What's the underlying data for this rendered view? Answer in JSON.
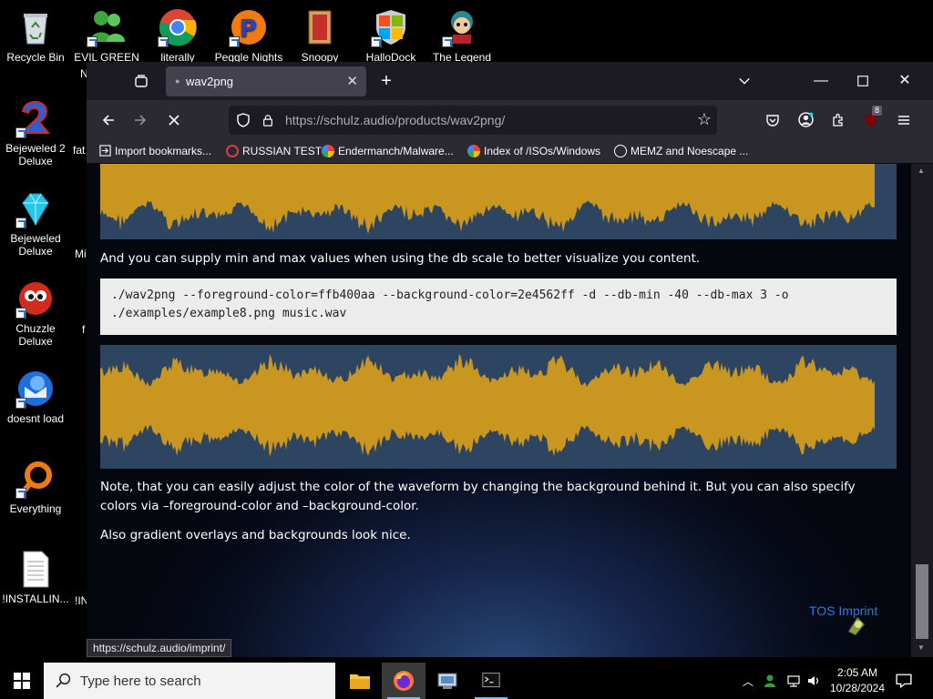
{
  "desktop": {
    "icons": [
      {
        "label": "Recycle Bin"
      },
      {
        "label": "EVIL GREEN"
      },
      {
        "label": "literally"
      },
      {
        "label": "Peggle Nights"
      },
      {
        "label": "Snoopy"
      },
      {
        "label": "HalloDock"
      },
      {
        "label": "The Legend"
      },
      {
        "label": "Bejeweled 2 Deluxe"
      },
      {
        "label": "Bejeweled Deluxe"
      },
      {
        "label": "Chuzzle Deluxe"
      },
      {
        "label": "doesnt load"
      },
      {
        "label": "Everything"
      },
      {
        "label": "!INSTALLIN..."
      }
    ],
    "partial_labels": {
      "fat": "fat",
      "mi": "Mi",
      "n": "N",
      "f": "f",
      "ni": "!IN"
    }
  },
  "browser": {
    "tab_title": "wav2png",
    "url_host": "https://schulz.audio",
    "url_path": "/products/wav2png/",
    "bookmarks": [
      {
        "label": "Import bookmarks..."
      },
      {
        "label": "RUSSIAN TEST"
      },
      {
        "label": "Endermanch/Malware..."
      },
      {
        "label": "Index of /ISOs/Windows"
      },
      {
        "label": "MEMZ and Noescape ..."
      }
    ],
    "extension_badge": "8",
    "status_link": "https://schulz.audio/imprint/"
  },
  "page": {
    "para_db": "And you can supply min and max values when using the db scale to better visualize you content.",
    "code": "./wav2png --foreground-color=ffb400aa --background-color=2e4562ff -d --db-min -40 --db-max 3 -o ./examples/example8.png music.wav",
    "para_color": "Note, that you can easily adjust the color of the waveform by changing the background behind it. But you can also specify colors via –foreground-color and –background-color.",
    "para_gradient": "Also gradient overlays and backgrounds look nice.",
    "footer_link": "TOS Imprint"
  },
  "taskbar": {
    "search_placeholder": "Type here to search",
    "time": "2:05 AM",
    "date": "10/28/2024"
  },
  "colors": {
    "waveform_fg": "#c9961f",
    "waveform_bg": "#2e4562",
    "link": "#2a7be0"
  }
}
